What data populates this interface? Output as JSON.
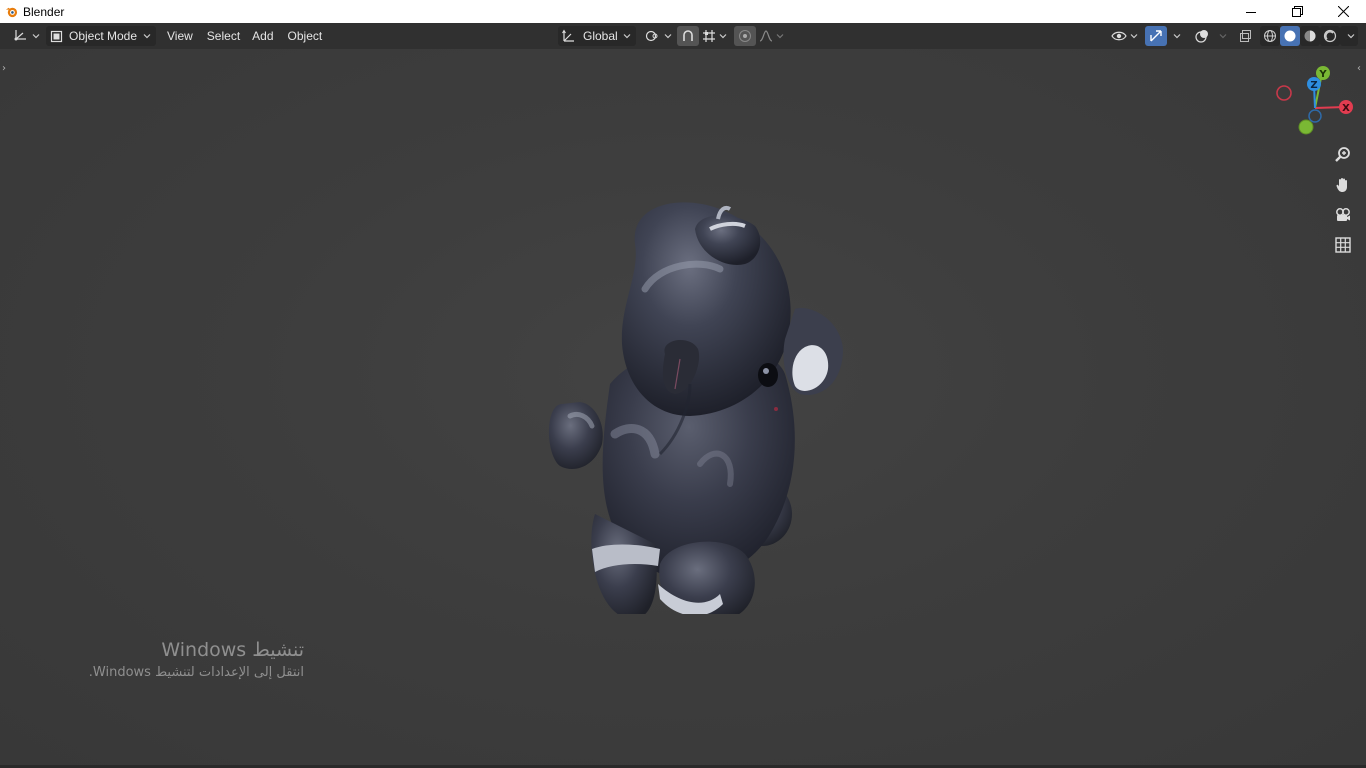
{
  "window": {
    "title": "Blender",
    "controls": [
      "minimize-icon",
      "restore-icon",
      "close-icon"
    ]
  },
  "header": {
    "editor_type_icon": "3d-viewport-icon",
    "mode": "Object Mode",
    "menus": [
      "View",
      "Select",
      "Add",
      "Object"
    ],
    "transform_orientation": "Global",
    "pivot_icon": "pivot-point-icon",
    "snap_icon": "snap-icon",
    "proportional_icon": "proportional-editing-icon",
    "right_icons": [
      "visibility-icon",
      "gizmo-icon",
      "overlays-icon",
      "xray-icon",
      "wireframe-shading-icon",
      "solid-shading-icon",
      "material-shading-icon",
      "rendered-shading-icon"
    ],
    "active_shading": "solid",
    "accent_color": "#4772b3"
  },
  "viewport": {
    "object": "teddy-bear-mesh",
    "nav_gizmo": {
      "axes": [
        "X",
        "Y",
        "Z"
      ],
      "x_color": "#e23c50",
      "y_color": "#7ab834",
      "z_color": "#2e8ee0"
    },
    "nav_buttons": [
      "zoom-icon",
      "pan-hand-icon",
      "camera-view-icon",
      "ortho-grid-icon"
    ]
  },
  "watermark": {
    "line1": "تنشيط Windows",
    "line2": "انتقل إلى الإعدادات لتنشيط Windows."
  }
}
